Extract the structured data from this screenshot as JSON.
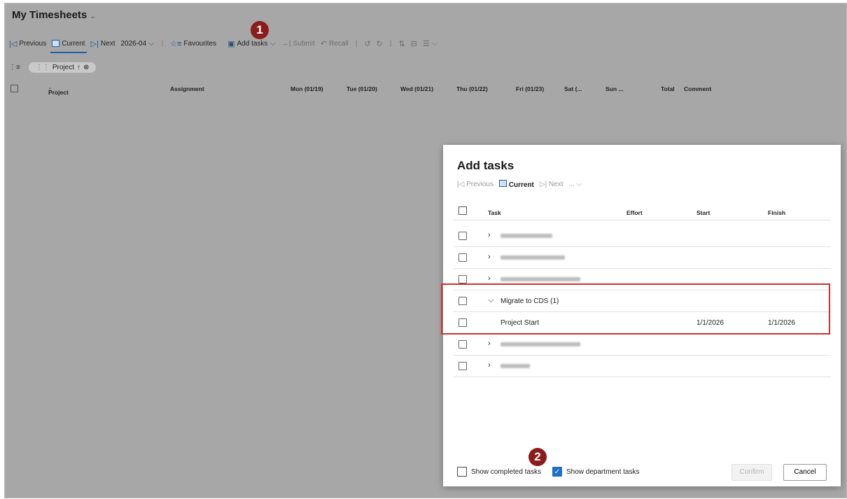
{
  "app": {
    "title": "My Timesheets"
  },
  "toolbar": {
    "previous": "Previous",
    "current": "Current",
    "next": "Next",
    "period": "2026-04",
    "favourites": "Favourites",
    "add_tasks": "Add tasks",
    "submit": "Submit",
    "recall": "Recall"
  },
  "filter": {
    "pill_label": "Project"
  },
  "grid": {
    "columns": [
      "Project",
      "Assignment",
      "Mon (01/19)",
      "Tue (01/20)",
      "Wed (01/21)",
      "Thu (01/22)",
      "Fri (01/23)",
      "Sat (...",
      "Sun ...",
      "Total",
      "Comment"
    ]
  },
  "badges": {
    "one": "1",
    "two": "2"
  },
  "dialog": {
    "title": "Add tasks",
    "nav": {
      "previous": "Previous",
      "current": "Current",
      "next": "Next",
      "more": "..."
    },
    "headers": {
      "task": "Task",
      "effort": "Effort",
      "start": "Start",
      "finish": "Finish"
    },
    "rows": [
      {
        "name": "Migrate to CDS (1)"
      },
      {
        "name": "Project Start",
        "start": "1/1/2026",
        "finish": "1/1/2026"
      }
    ],
    "show_completed": "Show completed tasks",
    "show_department": "Show department tasks",
    "confirm": "Confirm",
    "cancel": "Cancel"
  },
  "colors": {
    "accent": "#1f6fc5",
    "highlight": "#d32f2f",
    "badge": "#8a1c1c"
  }
}
